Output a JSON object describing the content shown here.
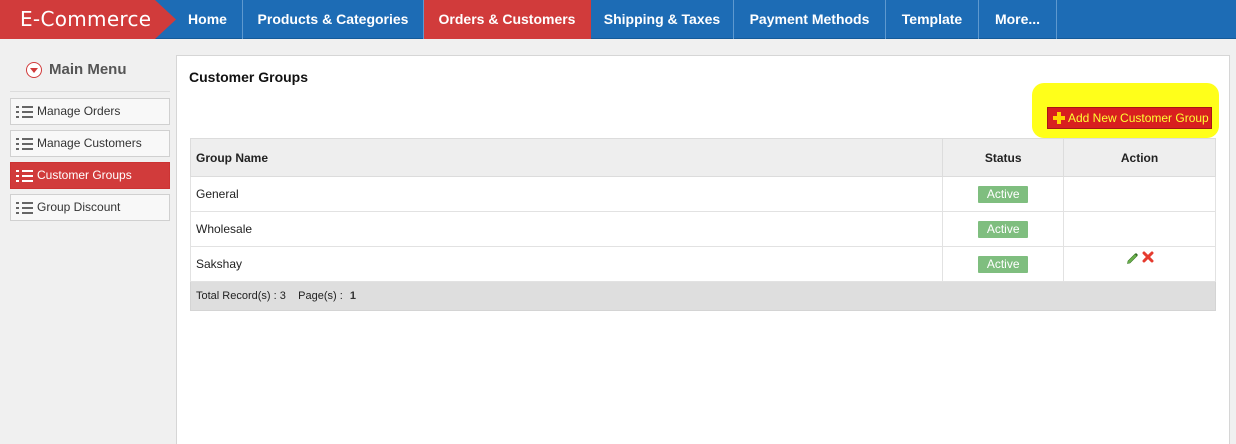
{
  "brand": "E-Commerce",
  "nav": [
    {
      "label": "Home"
    },
    {
      "label": "Products & Categories"
    },
    {
      "label": "Orders & Customers",
      "active": true
    },
    {
      "label": "Shipping & Taxes"
    },
    {
      "label": "Payment Methods"
    },
    {
      "label": "Template"
    },
    {
      "label": "More..."
    }
  ],
  "sidebar": {
    "title": "Main Menu",
    "items": [
      {
        "label": "Manage Orders"
      },
      {
        "label": "Manage Customers"
      },
      {
        "label": "Customer Groups",
        "active": true
      },
      {
        "label": "Group Discount"
      }
    ]
  },
  "main": {
    "title": "Customer Groups",
    "add_button": "Add New Customer Group",
    "table": {
      "headers": [
        "Group Name",
        "Status",
        "Action"
      ],
      "rows": [
        {
          "name": "General",
          "status": "Active",
          "actions": []
        },
        {
          "name": "Wholesale",
          "status": "Active",
          "actions": []
        },
        {
          "name": "Sakshay",
          "status": "Active",
          "actions": [
            "edit-icon",
            "delete-icon"
          ]
        }
      ],
      "footer": {
        "records_label": "Total Record(s) :",
        "records_value": "3",
        "pages_label": "Page(s) :",
        "pages_value": "1"
      }
    }
  },
  "colors": {
    "nav_bg": "#1d6cb5",
    "accent_red": "#d13b3b",
    "highlight": "#ffff1a",
    "badge_green": "#7fbe7f"
  }
}
